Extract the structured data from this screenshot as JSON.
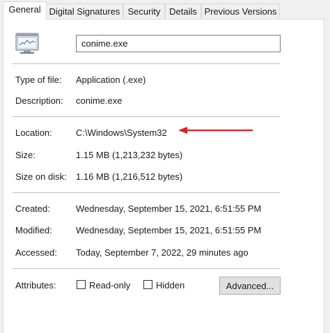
{
  "tabs": [
    {
      "label": "General",
      "active": true
    },
    {
      "label": "Digital Signatures",
      "active": false
    },
    {
      "label": "Security",
      "active": false
    },
    {
      "label": "Details",
      "active": false
    },
    {
      "label": "Previous Versions",
      "active": false
    }
  ],
  "file": {
    "icon": "application-window-icon",
    "name": "conime.exe"
  },
  "props": {
    "type_label": "Type of file:",
    "type_value": "Application (.exe)",
    "description_label": "Description:",
    "description_value": "conime.exe",
    "location_label": "Location:",
    "location_value": "C:\\Windows\\System32",
    "size_label": "Size:",
    "size_value": "1.15 MB (1,213,232 bytes)",
    "size_on_disk_label": "Size on disk:",
    "size_on_disk_value": "1.16 MB (1,216,512 bytes)",
    "created_label": "Created:",
    "created_value": "Wednesday, September 15, 2021, 6:51:55 PM",
    "modified_label": "Modified:",
    "modified_value": "Wednesday, September 15, 2021, 6:51:55 PM",
    "accessed_label": "Accessed:",
    "accessed_value": "Today, September 7, 2022, 29 minutes ago"
  },
  "attributes": {
    "label": "Attributes:",
    "readonly_label": "Read-only",
    "readonly_checked": false,
    "hidden_label": "Hidden",
    "hidden_checked": false,
    "advanced_button": "Advanced..."
  },
  "annotation": {
    "arrow_color": "#e0201f"
  }
}
